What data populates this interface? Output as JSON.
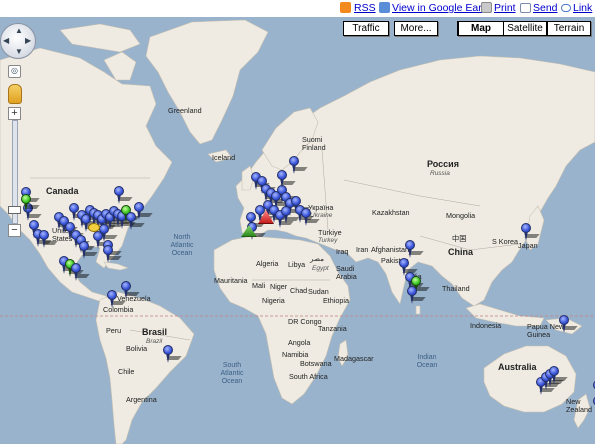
{
  "toolbar": {
    "rss": "RSS",
    "google_earth": "View in Google Earth",
    "print": "Print",
    "send": "Send",
    "link": "Link"
  },
  "map_types": {
    "traffic": "Traffic",
    "more": "More...",
    "map": "Map",
    "satellite": "Satellite",
    "terrain": "Terrain",
    "selected": "Map"
  },
  "labels": {
    "greenland": "Greenland",
    "canada": "Canada",
    "united_states": "United States",
    "iceland": "Iceland",
    "suomi": "Suomi",
    "finland": "Finland",
    "russia_native": "Россия",
    "russia": "Russia",
    "ukraine": "Україна",
    "ukraine_en": "Ukraine",
    "kazakhstan": "Kazakhstan",
    "mongolia": "Mongolia",
    "turkiye": "Türkiye",
    "turkey": "Turkey",
    "iraq": "Iraq",
    "iran": "Iran",
    "afghanistan": "Afghanistan",
    "pakistan": "Pakistan",
    "india": "India",
    "china_native": "中国",
    "china": "China",
    "s_korea": "S Korea",
    "japan": "Japan",
    "thailand": "Thailand",
    "indonesia": "Indonesia",
    "png": "Papua New Guinea",
    "australia": "Australia",
    "new_zealand": "New Zealand",
    "algeria": "Algeria",
    "libya": "Libya",
    "egypt_native": "مصر",
    "egypt": "Egypt",
    "mauritania": "Mauritania",
    "mali": "Mali",
    "niger": "Niger",
    "chad": "Chad",
    "sudan": "Sudan",
    "saudi": "Saudi Arabia",
    "nigeria": "Nigeria",
    "ethiopia": "Ethiopia",
    "drc": "DR Congo",
    "tanzania": "Tanzania",
    "angola": "Angola",
    "namibia": "Namibia",
    "botswana": "Botswana",
    "madagascar": "Madagascar",
    "south_africa": "South Africa",
    "venezuela": "Venezuela",
    "colombia": "Colombia",
    "peru": "Peru",
    "brasil": "Brasil",
    "brazil": "Brazil",
    "bolivia": "Bolivia",
    "chile": "Chile",
    "argentina": "Argentina",
    "north_atlantic": "North Atlantic Ocean",
    "south_atlantic": "South Atlantic Ocean",
    "indian_ocean": "Indian Ocean",
    "south_pacific": "South Atlantic Ocean"
  },
  "colors": {
    "water": "#99b3cc",
    "land": "#efebe2",
    "pin_blue": "#3651d6",
    "pin_green": "#35c21f",
    "equator": "#c48080"
  },
  "markers": {
    "blue_count_visible": "many",
    "green_count_visible": 4
  }
}
